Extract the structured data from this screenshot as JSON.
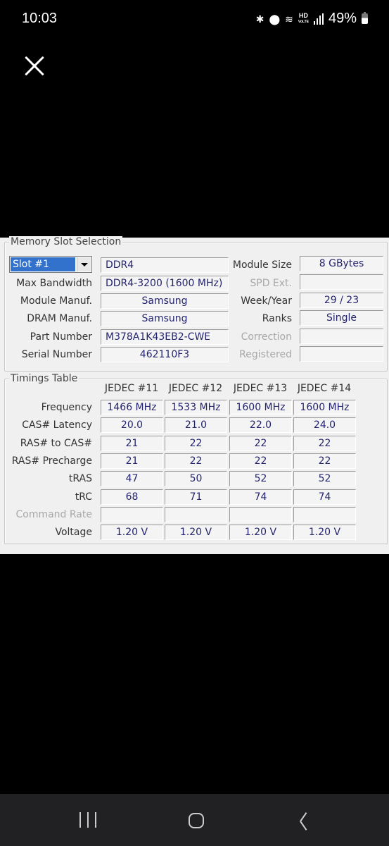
{
  "status_bar": {
    "time": "10:03",
    "icons": [
      "bluetooth-icon",
      "location-icon",
      "wifi6-icon",
      "hd-voice-icon",
      "signal-icon",
      "battery-icon"
    ],
    "hd_label": "HD",
    "hd_sub": "VoLTE",
    "battery_percent": "49%"
  },
  "viewer": {
    "close_icon": "close-icon"
  },
  "memory_slot": {
    "title": "Memory Slot Selection",
    "slot_selected": "Slot #1",
    "type": "DDR4",
    "labels": {
      "max_bandwidth": "Max Bandwidth",
      "module_manuf": "Module Manuf.",
      "dram_manuf": "DRAM Manuf.",
      "part_number": "Part Number",
      "serial_number": "Serial Number",
      "module_size": "Module Size",
      "spd_ext": "SPD Ext.",
      "week_year": "Week/Year",
      "ranks": "Ranks",
      "correction": "Correction",
      "registered": "Registered"
    },
    "values": {
      "max_bandwidth": "DDR4-3200 (1600 MHz)",
      "module_manuf": "Samsung",
      "dram_manuf": "Samsung",
      "part_number": "M378A1K43EB2-CWE",
      "serial_number": "462110F3",
      "module_size": "8 GBytes",
      "spd_ext": "",
      "week_year": "29 / 23",
      "ranks": "Single",
      "correction": "",
      "registered": ""
    }
  },
  "timings": {
    "title": "Timings Table",
    "columns": [
      "JEDEC #11",
      "JEDEC #12",
      "JEDEC #13",
      "JEDEC #14"
    ],
    "rows": [
      {
        "label": "Frequency",
        "values": [
          "1466 MHz",
          "1533 MHz",
          "1600 MHz",
          "1600 MHz"
        ]
      },
      {
        "label": "CAS# Latency",
        "values": [
          "20.0",
          "21.0",
          "22.0",
          "24.0"
        ]
      },
      {
        "label": "RAS# to CAS#",
        "values": [
          "21",
          "22",
          "22",
          "22"
        ]
      },
      {
        "label": "RAS# Precharge",
        "values": [
          "21",
          "22",
          "22",
          "22"
        ]
      },
      {
        "label": "tRAS",
        "values": [
          "47",
          "50",
          "52",
          "52"
        ]
      },
      {
        "label": "tRC",
        "values": [
          "68",
          "71",
          "74",
          "74"
        ]
      },
      {
        "label": "Command Rate",
        "values": [
          "",
          "",
          "",
          ""
        ]
      },
      {
        "label": "Voltage",
        "values": [
          "1.20 V",
          "1.20 V",
          "1.20 V",
          "1.20 V"
        ]
      }
    ]
  },
  "nav_bar": {
    "recents": "recents-icon",
    "home": "home-icon",
    "back": "back-icon"
  }
}
